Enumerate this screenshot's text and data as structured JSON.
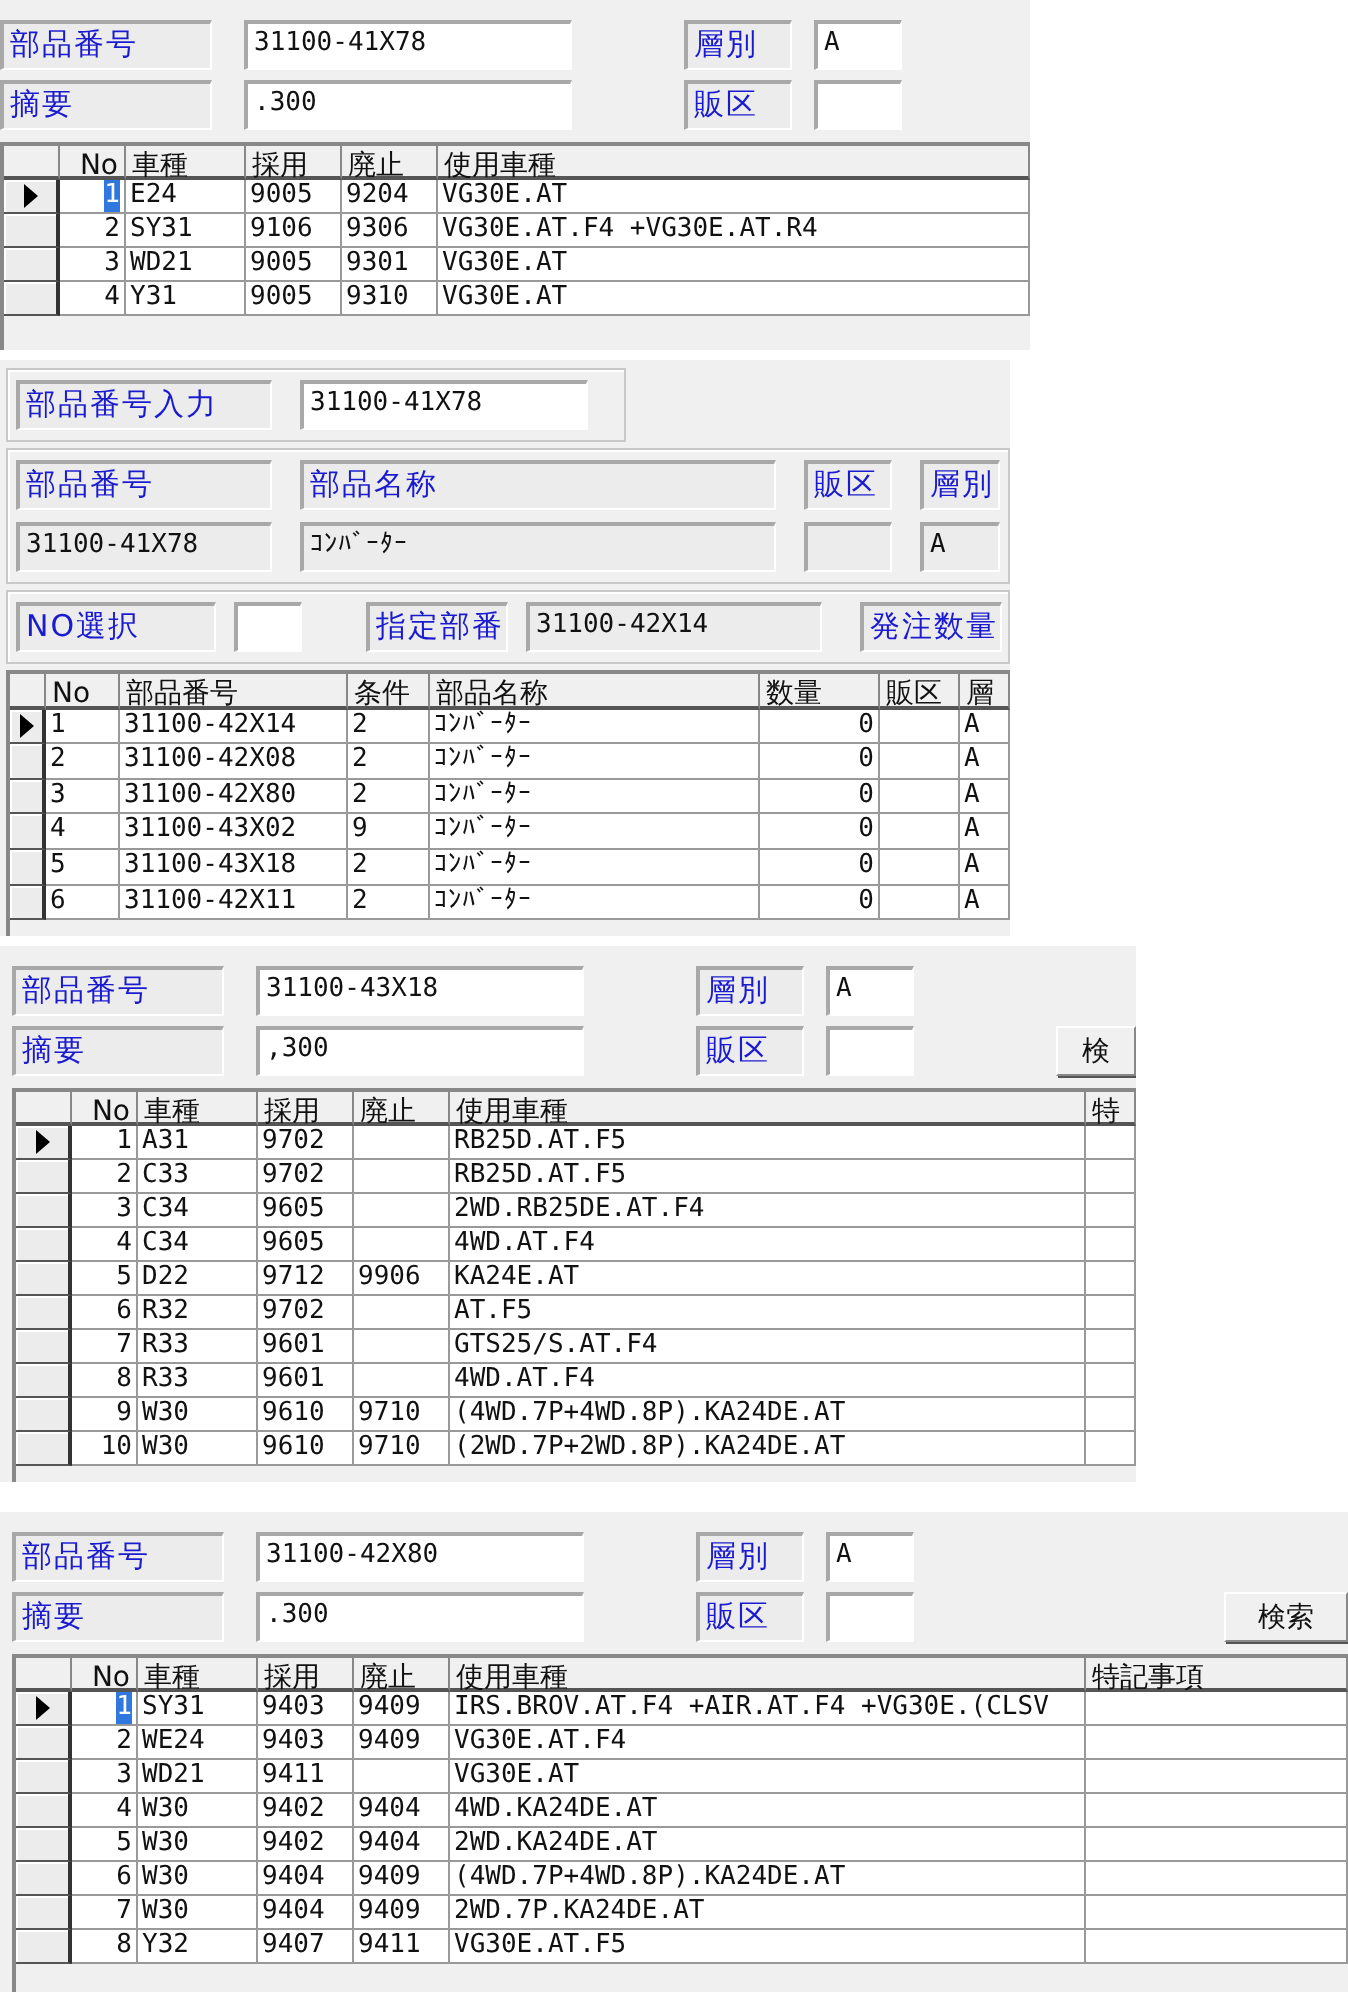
{
  "panels": [
    {
      "kind": "vehicle_lookup",
      "part_number": {
        "label": "部品番号",
        "value": "31100-41X78"
      },
      "summary": {
        "label": "摘要",
        "value": ".300"
      },
      "layer": {
        "label": "層別",
        "value": "A"
      },
      "sales_area": {
        "label": "販区"
      },
      "table": {
        "columns": [
          "No",
          "車種",
          "採用",
          "廃止",
          "使用車種"
        ],
        "rows": [
          {
            "selected": true,
            "focused": true,
            "cells": [
              "1",
              "E24",
              "9005",
              "9204",
              "VG30E.AT"
            ]
          },
          {
            "selected": false,
            "focused": false,
            "cells": [
              "2",
              "SY31",
              "9106",
              "9306",
              "VG30E.AT.F4 +VG30E.AT.R4"
            ]
          },
          {
            "selected": false,
            "focused": false,
            "cells": [
              "3",
              "WD21",
              "9005",
              "9301",
              "VG30E.AT"
            ]
          },
          {
            "selected": false,
            "focused": false,
            "cells": [
              "4",
              "Y31",
              "9005",
              "9310",
              "VG30E.AT"
            ]
          }
        ]
      }
    },
    {
      "kind": "parts_lookup",
      "input": {
        "label": "部品番号入力",
        "value": "31100-41X78"
      },
      "info": [
        {
          "label": "部品番号",
          "value": "31100-41X78"
        },
        {
          "label": "部品名称",
          "value": "ｺﾝﾊﾞｰﾀｰ"
        },
        {
          "label": "販区"
        },
        {
          "label": "層別",
          "value": "A"
        }
      ],
      "order": [
        {
          "label": "NO選択"
        },
        {
          "label": "指定部番",
          "value": "31100-42X14"
        },
        {
          "label": "発注数量"
        }
      ],
      "table": {
        "columns": [
          "No",
          "部品番号",
          "条件",
          "部品名称",
          "数量",
          "販区",
          "層"
        ],
        "rows": [
          {
            "selected": true,
            "focused": false,
            "cells": [
              "1",
              "31100-42X14",
              "2",
              "ｺﾝﾊﾞｰﾀｰ",
              "0",
              "",
              "A"
            ]
          },
          {
            "selected": false,
            "focused": false,
            "cells": [
              "2",
              "31100-42X08",
              "2",
              "ｺﾝﾊﾞｰﾀｰ",
              "0",
              "",
              "A"
            ]
          },
          {
            "selected": false,
            "focused": false,
            "cells": [
              "3",
              "31100-42X80",
              "2",
              "ｺﾝﾊﾞｰﾀｰ",
              "0",
              "",
              "A"
            ]
          },
          {
            "selected": false,
            "focused": false,
            "cells": [
              "4",
              "31100-43X02",
              "9",
              "ｺﾝﾊﾞｰﾀｰ",
              "0",
              "",
              "A"
            ]
          },
          {
            "selected": false,
            "focused": false,
            "cells": [
              "5",
              "31100-43X18",
              "2",
              "ｺﾝﾊﾞｰﾀｰ",
              "0",
              "",
              "A"
            ]
          },
          {
            "selected": false,
            "focused": false,
            "cells": [
              "6",
              "31100-42X11",
              "2",
              "ｺﾝﾊﾞｰﾀｰ",
              "0",
              "",
              "A"
            ]
          }
        ]
      }
    },
    {
      "kind": "vehicle_lookup",
      "part_number": {
        "label": "部品番号",
        "value": "31100-43X18"
      },
      "summary": {
        "label": "摘要",
        "value": ",300"
      },
      "layer": {
        "label": "層別",
        "value": "A"
      },
      "sales_area": {
        "label": "販区"
      },
      "search_button": "検",
      "table": {
        "columns": [
          "No",
          "車種",
          "採用",
          "廃止",
          "使用車種",
          "特"
        ],
        "rows": [
          {
            "selected": true,
            "focused": false,
            "cells": [
              "1",
              "A31",
              "9702",
              "",
              "RB25D.AT.F5"
            ]
          },
          {
            "selected": false,
            "focused": false,
            "cells": [
              "2",
              "C33",
              "9702",
              "",
              "RB25D.AT.F5"
            ]
          },
          {
            "selected": false,
            "focused": false,
            "cells": [
              "3",
              "C34",
              "9605",
              "",
              "2WD.RB25DE.AT.F4"
            ]
          },
          {
            "selected": false,
            "focused": false,
            "cells": [
              "4",
              "C34",
              "9605",
              "",
              "4WD.AT.F4"
            ]
          },
          {
            "selected": false,
            "focused": false,
            "cells": [
              "5",
              "D22",
              "9712",
              "9906",
              "KA24E.AT"
            ]
          },
          {
            "selected": false,
            "focused": false,
            "cells": [
              "6",
              "R32",
              "9702",
              "",
              "AT.F5"
            ]
          },
          {
            "selected": false,
            "focused": false,
            "cells": [
              "7",
              "R33",
              "9601",
              "",
              "GTS25/S.AT.F4"
            ]
          },
          {
            "selected": false,
            "focused": false,
            "cells": [
              "8",
              "R33",
              "9601",
              "",
              "4WD.AT.F4"
            ]
          },
          {
            "selected": false,
            "focused": false,
            "cells": [
              "9",
              "W30",
              "9610",
              "9710",
              "(4WD.7P+4WD.8P).KA24DE.AT"
            ]
          },
          {
            "selected": false,
            "focused": false,
            "cells": [
              "10",
              "W30",
              "9610",
              "9710",
              "(2WD.7P+2WD.8P).KA24DE.AT"
            ]
          }
        ]
      }
    },
    {
      "kind": "vehicle_lookup",
      "part_number": {
        "label": "部品番号",
        "value": "31100-42X80"
      },
      "summary": {
        "label": "摘要",
        "value": ".300"
      },
      "layer": {
        "label": "層別",
        "value": "A"
      },
      "sales_area": {
        "label": "販区"
      },
      "search_button": "検索",
      "table": {
        "columns": [
          "No",
          "車種",
          "採用",
          "廃止",
          "使用車種",
          "特記事項"
        ],
        "rows": [
          {
            "selected": true,
            "focused": true,
            "cells": [
              "1",
              "SY31",
              "9403",
              "9409",
              "IRS.BROV.AT.F4 +AIR.AT.F4 +VG30E.(CLSV"
            ]
          },
          {
            "selected": false,
            "focused": false,
            "cells": [
              "2",
              "WE24",
              "9403",
              "9409",
              "VG30E.AT.F4"
            ]
          },
          {
            "selected": false,
            "focused": false,
            "cells": [
              "3",
              "WD21",
              "9411",
              "",
              "VG30E.AT"
            ]
          },
          {
            "selected": false,
            "focused": false,
            "cells": [
              "4",
              "W30",
              "9402",
              "9404",
              "4WD.KA24DE.AT"
            ]
          },
          {
            "selected": false,
            "focused": false,
            "cells": [
              "5",
              "W30",
              "9402",
              "9404",
              "2WD.KA24DE.AT"
            ]
          },
          {
            "selected": false,
            "focused": false,
            "cells": [
              "6",
              "W30",
              "9404",
              "9409",
              "(4WD.7P+4WD.8P).KA24DE.AT"
            ]
          },
          {
            "selected": false,
            "focused": false,
            "cells": [
              "7",
              "W30",
              "9404",
              "9409",
              "2WD.7P.KA24DE.AT"
            ]
          },
          {
            "selected": false,
            "focused": false,
            "cells": [
              "8",
              "Y32",
              "9407",
              "9411",
              "VG30E.AT.F5"
            ]
          }
        ]
      }
    }
  ]
}
